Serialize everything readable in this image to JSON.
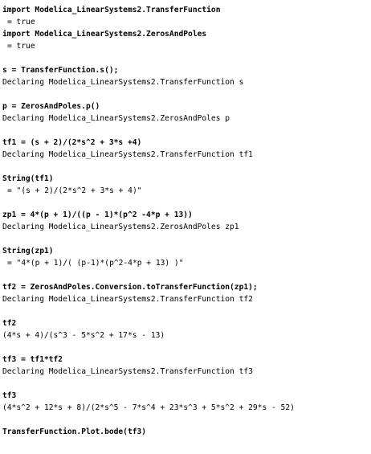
{
  "console": {
    "lines": [
      {
        "kind": "cmd",
        "text": "import Modelica_LinearSystems2.TransferFunction"
      },
      {
        "kind": "res",
        "text": "= true"
      },
      {
        "kind": "cmd",
        "text": "import Modelica_LinearSystems2.ZerosAndPoles"
      },
      {
        "kind": "res",
        "text": "= true"
      },
      {
        "kind": "blank",
        "text": ""
      },
      {
        "kind": "cmd",
        "text": "s = TransferFunction.s();"
      },
      {
        "kind": "msg",
        "text": "Declaring Modelica_LinearSystems2.TransferFunction s"
      },
      {
        "kind": "blank",
        "text": ""
      },
      {
        "kind": "cmd",
        "text": "p = ZerosAndPoles.p()"
      },
      {
        "kind": "msg",
        "text": "Declaring Modelica_LinearSystems2.ZerosAndPoles p"
      },
      {
        "kind": "blank",
        "text": ""
      },
      {
        "kind": "cmd",
        "text": "tf1 = (s + 2)/(2*s^2 + 3*s +4)"
      },
      {
        "kind": "msg",
        "text": "Declaring Modelica_LinearSystems2.TransferFunction tf1"
      },
      {
        "kind": "blank",
        "text": ""
      },
      {
        "kind": "cmd",
        "text": "String(tf1)"
      },
      {
        "kind": "res",
        "text": "= \"(s + 2)/(2*s^2 + 3*s + 4)\""
      },
      {
        "kind": "blank",
        "text": ""
      },
      {
        "kind": "cmd",
        "text": "zp1 = 4*(p + 1)/((p - 1)*(p^2 -4*p + 13))"
      },
      {
        "kind": "msg",
        "text": "Declaring Modelica_LinearSystems2.ZerosAndPoles zp1"
      },
      {
        "kind": "blank",
        "text": ""
      },
      {
        "kind": "cmd",
        "text": "String(zp1)"
      },
      {
        "kind": "res",
        "text": "= \"4*(p + 1)/( (p-1)*(p^2-4*p + 13) )\""
      },
      {
        "kind": "blank",
        "text": ""
      },
      {
        "kind": "cmd",
        "text": "tf2 = ZerosAndPoles.Conversion.toTransferFunction(zp1);"
      },
      {
        "kind": "msg",
        "text": "Declaring Modelica_LinearSystems2.TransferFunction tf2"
      },
      {
        "kind": "blank",
        "text": ""
      },
      {
        "kind": "cmd",
        "text": "tf2"
      },
      {
        "kind": "msg",
        "text": "(4*s + 4)/(s^3 - 5*s^2 + 17*s - 13)"
      },
      {
        "kind": "blank",
        "text": ""
      },
      {
        "kind": "cmd",
        "text": "tf3 = tf1*tf2"
      },
      {
        "kind": "msg",
        "text": "Declaring Modelica_LinearSystems2.TransferFunction tf3"
      },
      {
        "kind": "blank",
        "text": ""
      },
      {
        "kind": "cmd",
        "text": "tf3"
      },
      {
        "kind": "msg",
        "text": "(4*s^2 + 12*s + 8)/(2*s^5 - 7*s^4 + 23*s^3 + 5*s^2 + 29*s - 52)"
      },
      {
        "kind": "blank",
        "text": ""
      },
      {
        "kind": "cmd",
        "text": "TransferFunction.Plot.bode(tf3)"
      }
    ]
  }
}
